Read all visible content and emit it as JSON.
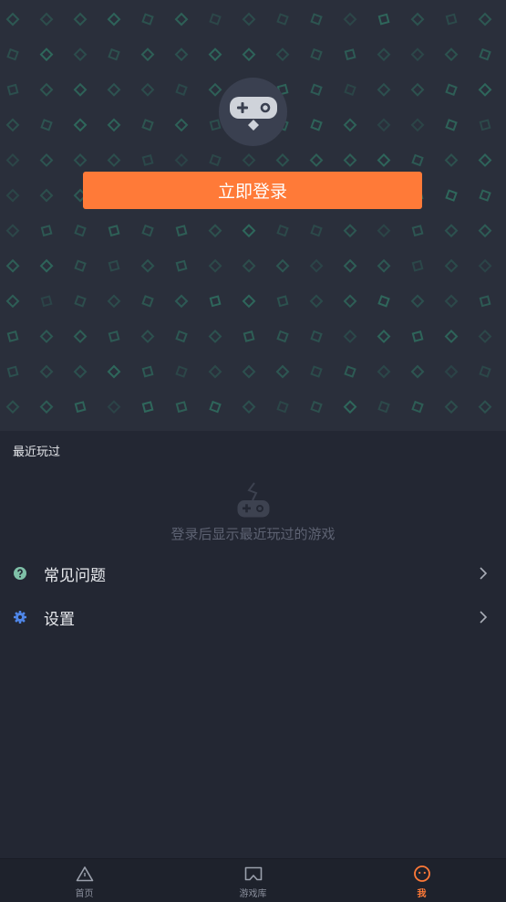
{
  "colors": {
    "accent": "#ff7a38",
    "background": "#232733",
    "hero_background": "#2a2f3b",
    "pattern": "#2f6b5e",
    "faq_icon": "#7fc0a8",
    "settings_icon": "#4f86e8"
  },
  "hero": {
    "avatar_icon": "gamepad-icon",
    "login_button_label": "立即登录"
  },
  "recent": {
    "title": "最近玩过",
    "empty_icon": "gamepad-icon",
    "empty_text": "登录后显示最近玩过的游戏"
  },
  "menu": {
    "items": [
      {
        "label": "常见问题",
        "icon": "help-icon"
      },
      {
        "label": "设置",
        "icon": "gear-icon"
      }
    ]
  },
  "tabbar": {
    "tabs": [
      {
        "label": "首页",
        "icon": "triangle-icon",
        "active": false
      },
      {
        "label": "游戏库",
        "icon": "library-icon",
        "active": false
      },
      {
        "label": "我",
        "icon": "face-icon",
        "active": true
      }
    ]
  }
}
